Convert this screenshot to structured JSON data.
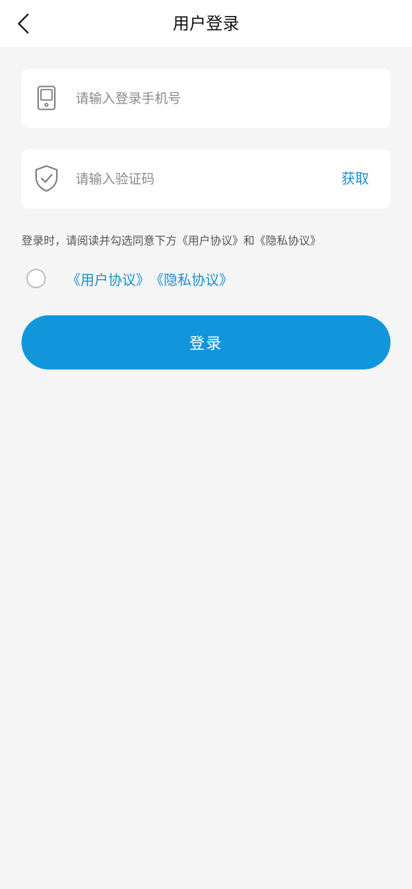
{
  "header": {
    "title": "用户登录"
  },
  "form": {
    "phone": {
      "placeholder": "请输入登录手机号",
      "value": ""
    },
    "code": {
      "placeholder": "请输入验证码",
      "value": "",
      "get_code_label": "获取"
    }
  },
  "agreement": {
    "notice": "登录时，请阅读并勾选同意下方《用户协议》和《隐私协议》",
    "checked": false,
    "links": [
      "《用户协议》",
      "《隐私协议》"
    ]
  },
  "login_button": {
    "label": "登录"
  },
  "colors": {
    "accent": "#1296db",
    "link": "#1c8fc8",
    "background": "#f5f5f5"
  },
  "icons": {
    "back": "chevron-left-icon",
    "phone": "phone-icon",
    "shield": "shield-check-icon"
  }
}
